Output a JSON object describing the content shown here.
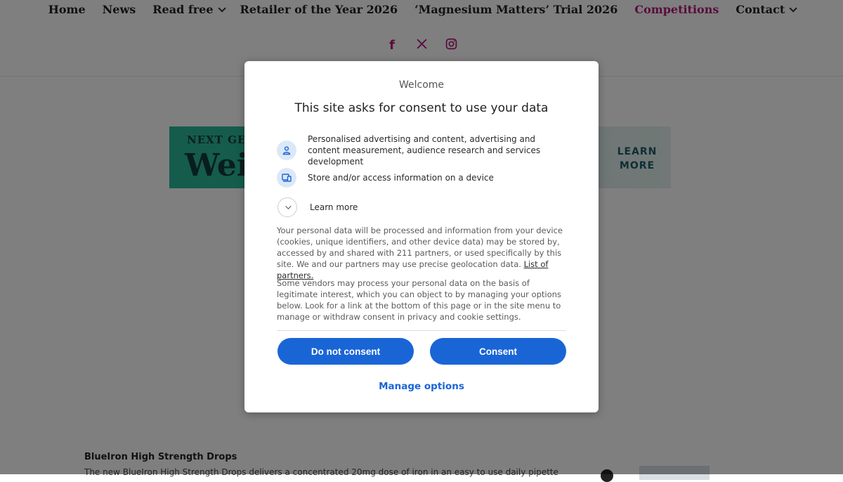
{
  "nav": {
    "items": [
      {
        "label": "Home"
      },
      {
        "label": "News"
      },
      {
        "label": "Read free"
      },
      {
        "label": "Retailer of the Year 2026"
      },
      {
        "label": "‘Magnesium Matters’ Trial 2026"
      },
      {
        "label": "Competitions"
      },
      {
        "label": "Contact"
      }
    ],
    "social": [
      "facebook-icon",
      "x-icon",
      "instagram-icon"
    ],
    "accent_color": "#b3197a"
  },
  "banner": {
    "line1": "NEXT GEN",
    "line2": "Weig",
    "cta": "LEARN MORE"
  },
  "article": {
    "title": "BlueIron High Strength Drops",
    "snippet": "The new BlueIron High Strength Drops delivers a concentrated 20mg dose of iron in an easy to use daily pipette"
  },
  "consent": {
    "welcome": "Welcome",
    "headline": "This site asks for consent to use your data",
    "purposes": [
      {
        "icon": "person-icon",
        "text": "Personalised advertising and content, advertising and content measurement, audience research and services development"
      },
      {
        "icon": "device-icon",
        "text": "Store and/or access information on a device"
      }
    ],
    "learn_more": "Learn more",
    "para1": "Your personal data will be processed and information from your device (cookies, unique identifiers, and other device data) may be stored by, accessed by and shared with 211 partners, or used specifically by this site. We and our partners may use precise geolocation data.",
    "partners_link": "List of partners.",
    "para2": "Some vendors may process your personal data on the basis of legitimate interest, which you can object to by managing your options below. Look for a link at the bottom of this page or in the site menu to manage or withdraw consent in privacy and cookie settings.",
    "do_not_consent": "Do not consent",
    "consent": "Consent",
    "manage_options": "Manage options",
    "button_color": "#1a65d6"
  }
}
